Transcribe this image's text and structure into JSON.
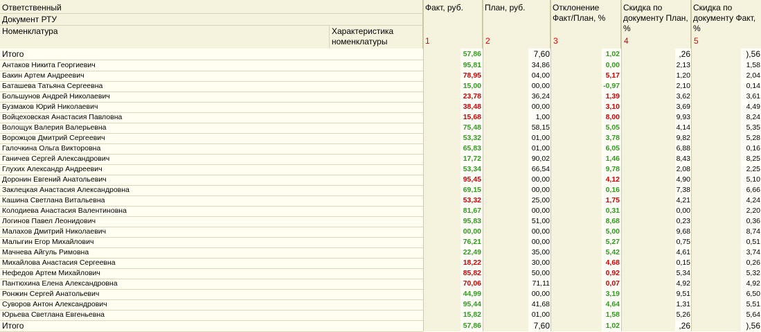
{
  "header": {
    "responsible": "Ответственный",
    "document": "Документ РТУ",
    "nomenclature": "Номенклатура",
    "characteristic": "Характеристика номенклатуры",
    "fact": "Факт, руб.",
    "plan": "План, руб.",
    "deviation": "Отклонение Факт/План, %",
    "discount_plan": "Скидка по документу План, %",
    "discount_fact": "Скидка по документу Факт, %",
    "col_numbers": [
      "1",
      "2",
      "3",
      "4",
      "5"
    ]
  },
  "total_label": "Итого",
  "totals": {
    "fact": "57,86",
    "plan": "7,60",
    "deviation": "1,02",
    "discount_plan": ",26",
    "discount_fact": "),56"
  },
  "rows": [
    {
      "name": "Антаков Никита Георгиевич",
      "fact": "95,81",
      "fact_color": "green",
      "plan": "34,86",
      "dev": "0,00",
      "dev_color": "green",
      "dp": "2,13",
      "df": "1,58"
    },
    {
      "name": "Бакин Артем Андреевич",
      "fact": "78,95",
      "fact_color": "red",
      "plan": "04,00",
      "dev": "5,17",
      "dev_color": "red",
      "dp": "1,20",
      "df": "2,04"
    },
    {
      "name": "Баташева Татьяна Сергеевна",
      "fact": "15,00",
      "fact_color": "green",
      "plan": "00,00",
      "dev": "-0,97",
      "dev_color": "green",
      "dp": "2,10",
      "df": "0,14"
    },
    {
      "name": "Большунов Андрей Николаевич",
      "fact": "23,78",
      "fact_color": "red",
      "plan": "36,24",
      "dev": "1,39",
      "dev_color": "red",
      "dp": "3,62",
      "df": "3,61"
    },
    {
      "name": "Бузмаков Юрий Николаевич",
      "fact": "38,48",
      "fact_color": "red",
      "plan": "00,00",
      "dev": "3,10",
      "dev_color": "red",
      "dp": "3,69",
      "df": "4,49"
    },
    {
      "name": "Войцеховская Анастасия Павловна",
      "fact": "15,68",
      "fact_color": "red",
      "plan": "1,00",
      "dev": "8,00",
      "dev_color": "red",
      "dp": "9,93",
      "df": "8,24"
    },
    {
      "name": "Волощук Валерия Валерьевна",
      "fact": "75,48",
      "fact_color": "green",
      "plan": "58,15",
      "dev": "5,05",
      "dev_color": "green",
      "dp": "4,14",
      "df": "5,35"
    },
    {
      "name": "Ворожцов Дмитрий Сергеевич",
      "fact": "53,32",
      "fact_color": "green",
      "plan": "01,00",
      "dev": "3,78",
      "dev_color": "green",
      "dp": "9,82",
      "df": "5,28"
    },
    {
      "name": "Галочкина Ольга Викторовна",
      "fact": "65,83",
      "fact_color": "green",
      "plan": "01,00",
      "dev": "6,05",
      "dev_color": "green",
      "dp": "6,88",
      "df": "0,16"
    },
    {
      "name": "Ганичев Сергей Александрович",
      "fact": "17,72",
      "fact_color": "green",
      "plan": "90,02",
      "dev": "1,46",
      "dev_color": "green",
      "dp": "8,43",
      "df": "8,25"
    },
    {
      "name": "Глухих Александр Андреевич",
      "fact": "53,34",
      "fact_color": "green",
      "plan": "66,54",
      "dev": "9,78",
      "dev_color": "green",
      "dp": "2,08",
      "df": "2,25"
    },
    {
      "name": "Доронин Евгений Анатольевич",
      "fact": "95,45",
      "fact_color": "red",
      "plan": "00,00",
      "dev": "4,12",
      "dev_color": "red",
      "dp": "4,90",
      "df": "5,10"
    },
    {
      "name": "Заклецкая Анастасия Александровна",
      "fact": "69,15",
      "fact_color": "green",
      "plan": "00,00",
      "dev": "0,16",
      "dev_color": "green",
      "dp": "7,38",
      "df": "6,66"
    },
    {
      "name": "Кашина Светлана Витальевна",
      "fact": "53,32",
      "fact_color": "red",
      "plan": "25,00",
      "dev": "1,75",
      "dev_color": "red",
      "dp": "4,21",
      "df": "4,24"
    },
    {
      "name": "Колодиева Анастасия Валентиновна",
      "fact": "81,67",
      "fact_color": "green",
      "plan": "00,00",
      "dev": "0,31",
      "dev_color": "green",
      "dp": "0,00",
      "df": "2,20"
    },
    {
      "name": "Логинов Павел Леонидович",
      "fact": "95,83",
      "fact_color": "green",
      "plan": "51,00",
      "dev": "8,68",
      "dev_color": "green",
      "dp": "0,23",
      "df": "0,36"
    },
    {
      "name": "Малахов Дмитрий Николаевич",
      "fact": "00,00",
      "fact_color": "green",
      "plan": "00,00",
      "dev": "5,00",
      "dev_color": "green",
      "dp": "9,68",
      "df": "8,74"
    },
    {
      "name": "Малыгин Егор Михайлович",
      "fact": "76,21",
      "fact_color": "green",
      "plan": "00,00",
      "dev": "5,27",
      "dev_color": "green",
      "dp": "0,75",
      "df": "0,51"
    },
    {
      "name": "Мачнева Айгуль Римовна",
      "fact": "22,49",
      "fact_color": "green",
      "plan": "35,00",
      "dev": "5,42",
      "dev_color": "green",
      "dp": "4,61",
      "df": "3,74"
    },
    {
      "name": "Михайлова Анастасия Сергеевна",
      "fact": "18,22",
      "fact_color": "red",
      "plan": "30,00",
      "dev": "4,68",
      "dev_color": "red",
      "dp": "0,15",
      "df": "0,26"
    },
    {
      "name": "Нефедов Артем Михайлович",
      "fact": "85,82",
      "fact_color": "red",
      "plan": "50,00",
      "dev": "0,92",
      "dev_color": "red",
      "dp": "5,34",
      "df": "5,32"
    },
    {
      "name": "Пантюхина Елена Александровна",
      "fact": "70,06",
      "fact_color": "red",
      "plan": "71,11",
      "dev": "0,07",
      "dev_color": "red",
      "dp": "4,92",
      "df": "4,92"
    },
    {
      "name": "Ронжин Сергей Анатольевич",
      "fact": "44,99",
      "fact_color": "green",
      "plan": "00,00",
      "dev": "3,19",
      "dev_color": "green",
      "dp": "9,51",
      "df": "6,50"
    },
    {
      "name": "Суворов Антон Александрович",
      "fact": "95,44",
      "fact_color": "green",
      "plan": "41,68",
      "dev": "4,64",
      "dev_color": "green",
      "dp": "1,31",
      "df": "5,51"
    },
    {
      "name": "Юрьева Светлана Евгеньевна",
      "fact": "15,82",
      "fact_color": "green",
      "plan": "01,00",
      "dev": "1,58",
      "dev_color": "green",
      "dp": "5,26",
      "df": "5,64"
    }
  ]
}
